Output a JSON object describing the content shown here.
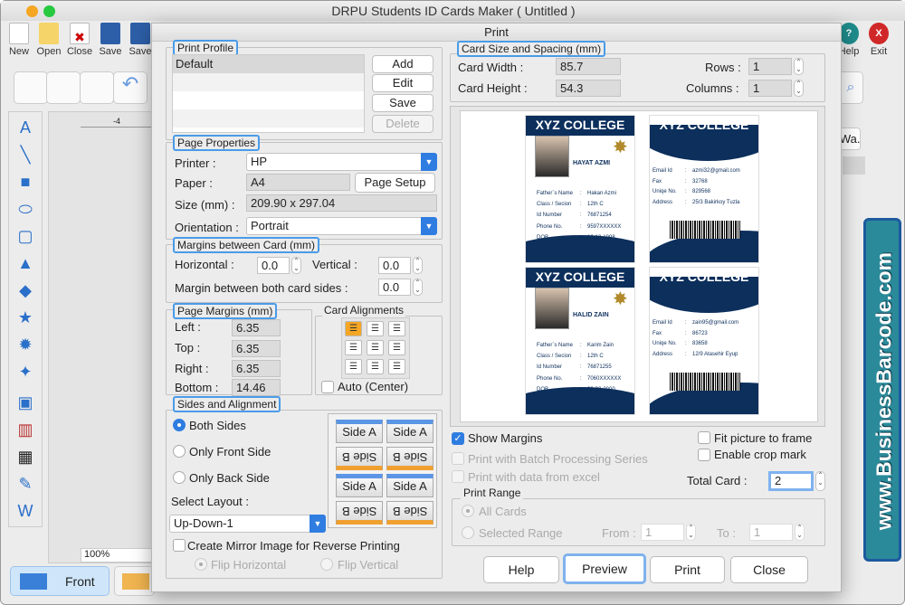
{
  "app": {
    "title": "DRPU Students ID Cards Maker ( Untitled )",
    "toolbar": [
      {
        "label": "New",
        "icon": "new-file-icon"
      },
      {
        "label": "Open",
        "icon": "open-folder-icon"
      },
      {
        "label": "Close",
        "icon": "close-file-icon"
      },
      {
        "label": "Save",
        "icon": "save-icon"
      },
      {
        "label": "Save",
        "icon": "save-as-icon"
      }
    ],
    "help_label": "Help",
    "exit_label": "Exit",
    "right_button_label": "d Wa...",
    "zoom_value": "100%",
    "ruler_mark": "-4",
    "tabs": {
      "front": "Front"
    },
    "watermark": "www.BusinessBarcode.com",
    "colors": {
      "accent": "#2f7de1",
      "card_navy": "#0c2f5c",
      "watermark_bg": "#2b8a9a"
    }
  },
  "dialog": {
    "title": "Print",
    "print_profile": {
      "label": "Print Profile",
      "items": [
        "Default"
      ],
      "buttons": {
        "add": "Add",
        "edit": "Edit",
        "save": "Save",
        "delete": "Delete"
      }
    },
    "page_properties": {
      "label": "Page Properties",
      "printer_label": "Printer :",
      "printer": "HP",
      "paper_label": "Paper :",
      "paper": "A4",
      "page_setup": "Page Setup",
      "size_label": "Size (mm) :",
      "size": "209.90 x 297.04",
      "orientation_label": "Orientation :",
      "orientation": "Portrait"
    },
    "margins_between_card": {
      "label": "Margins between Card (mm)",
      "horizontal_label": "Horizontal :",
      "horizontal": "0.0",
      "vertical_label": "Vertical :",
      "vertical": "0.0",
      "both_sides_label": "Margin between both card sides :",
      "both_sides": "0.0"
    },
    "page_margins": {
      "label": "Page Margins (mm)",
      "left_label": "Left :",
      "left": "6.35",
      "top_label": "Top :",
      "top": "6.35",
      "right_label": "Right :",
      "right": "6.35",
      "bottom_label": "Bottom :",
      "bottom": "14.46"
    },
    "card_alignments": {
      "label": "Card Alignments",
      "selected": "top-left",
      "auto_center": "Auto (Center)"
    },
    "sides_alignment": {
      "label": "Sides and Alignment",
      "options": [
        "Both Sides",
        "Only Front Side",
        "Only Back Side"
      ],
      "selected": "Both Sides",
      "select_layout_label": "Select Layout :",
      "layout": "Up-Down-1",
      "side_a": "Side A",
      "side_b": "Side B",
      "mirror_label": "Create Mirror Image for Reverse Printing",
      "flip_horizontal": "Flip Horizontal",
      "flip_vertical": "Flip Vertical"
    },
    "card_size": {
      "label": "Card Size and Spacing (mm)",
      "width_label": "Card Width :",
      "width": "85.7",
      "height_label": "Card Height :",
      "height": "54.3",
      "rows_label": "Rows :",
      "rows": "1",
      "columns_label": "Columns :",
      "columns": "1"
    },
    "cards": [
      {
        "college": "XYZ COLLEGE",
        "name": "HAYAT AZMI",
        "front_rows": [
          [
            "Father`s Name",
            "Hakan Azmi"
          ],
          [
            "Class / Secion",
            "12th C"
          ],
          [
            "Id Number",
            "76871254"
          ],
          [
            "Phone No.",
            "9597XXXXXX"
          ],
          [
            "DOB.",
            "12-12-1998"
          ]
        ],
        "back_rows": [
          [
            "Email Id",
            "azmi32@gmail.com"
          ],
          [
            "Fax",
            "32768"
          ],
          [
            "Uniqe No.",
            "829568"
          ],
          [
            "Address",
            "25/3 Bakirkoy Tuzla"
          ]
        ]
      },
      {
        "college": "XYZ COLLEGE",
        "name": "HALID ZAIN",
        "front_rows": [
          [
            "Father`s Name",
            "Karim Zain"
          ],
          [
            "Class / Secion",
            "12th C"
          ],
          [
            "Id Number",
            "76871255"
          ],
          [
            "Phone No.",
            "7060XXXXXX"
          ],
          [
            "DOB.",
            "09-02-2000"
          ]
        ],
        "back_rows": [
          [
            "Email Id",
            "zain95@gmail.com"
          ],
          [
            "Fax",
            "86723"
          ],
          [
            "Uniqe No.",
            "83658"
          ],
          [
            "Address",
            "12/9 Atasehir Eyup"
          ]
        ]
      }
    ],
    "options": {
      "show_margins": "Show Margins",
      "batch": "Print with Batch Processing Series",
      "excel": "Print with data from excel",
      "fit_picture": "Fit picture to frame",
      "crop_mark": "Enable crop mark",
      "total_card_label": "Total Card :",
      "total_card": "2"
    },
    "print_range": {
      "label": "Print Range",
      "all_cards": "All Cards",
      "selected_range": "Selected Range",
      "from_label": "From :",
      "from": "1",
      "to_label": "To :",
      "to": "1"
    },
    "buttons": {
      "help": "Help",
      "preview": "Preview",
      "print": "Print",
      "close": "Close"
    }
  }
}
